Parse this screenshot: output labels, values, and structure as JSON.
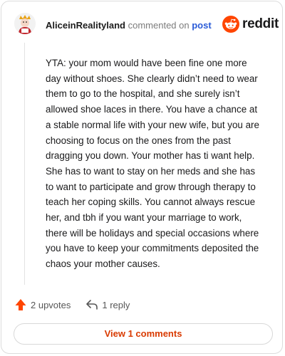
{
  "header": {
    "username": "AliceinRealityland",
    "action_text": "commented on",
    "post_link": "post"
  },
  "brand": {
    "logo_text": "reddit",
    "icon": "reddit-snoo-icon",
    "color": "#ff4500"
  },
  "comment": {
    "body": "YTA: your mom would have been fine one more day without shoes. She clearly didn’t need to wear them to go to the hospital, and she surely isn’t allowed shoe laces in there. You have a chance at a stable normal life with your new wife, but you are choosing to focus on the ones from the past dragging you down. Your mother has ti want help. She has to want to stay on her meds and she has to want to participate and grow through therapy to teach her coping skills. You cannot always rescue her, and tbh if you want your marriage to work, there will be holidays and special occasions where you have to keep your commitments deposited the chaos your mother causes."
  },
  "actions": {
    "upvotes_label": "2 upvotes",
    "upvote_icon": "upvote-arrow-icon",
    "upvote_color": "#ff4500",
    "replies_label": "1 reply",
    "reply_icon": "reply-arrow-icon"
  },
  "footer": {
    "view_comments_label": "View 1 comments",
    "accent_color": "#d93a00"
  }
}
